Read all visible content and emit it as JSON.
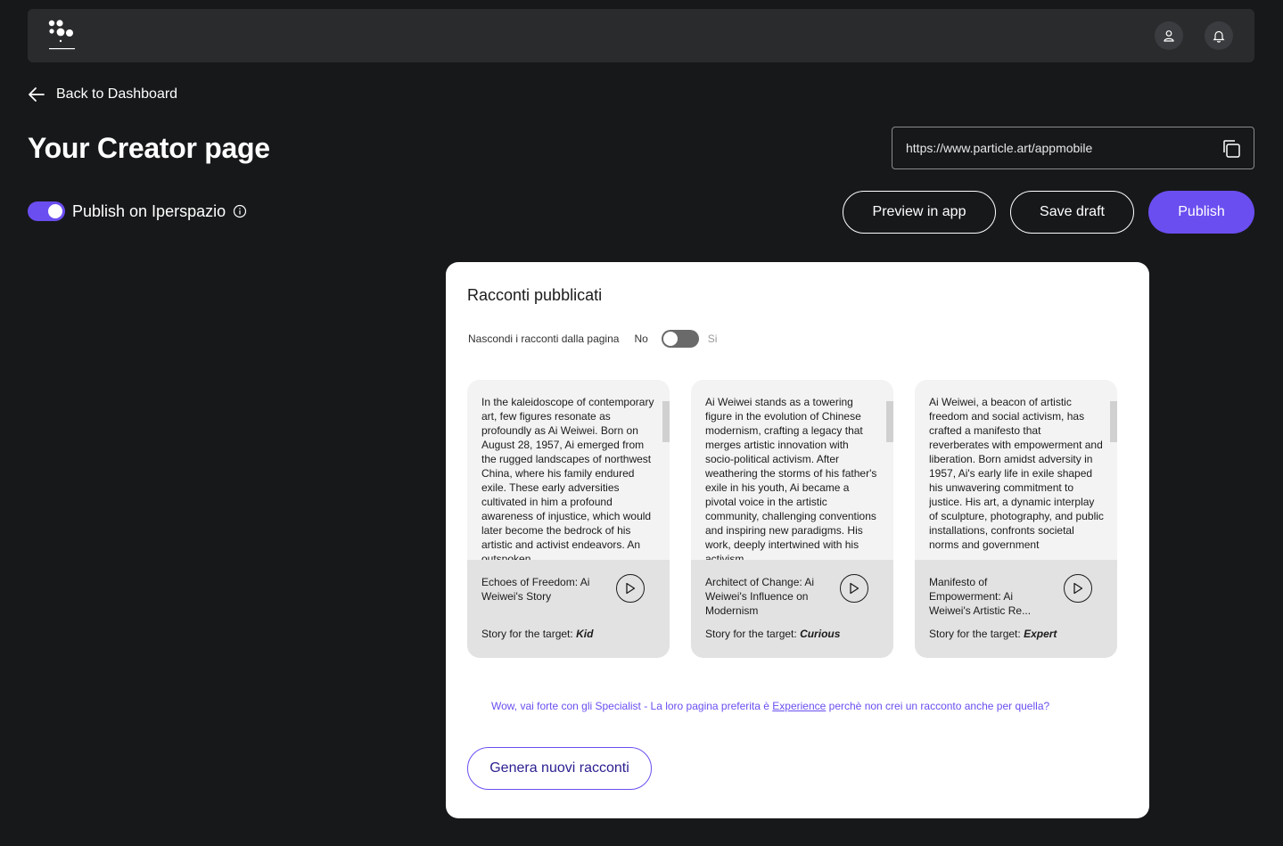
{
  "topbar": {
    "logo_icon": "particle-logo-icon",
    "user_icon": "user-icon",
    "bell_icon": "bell-icon"
  },
  "nav": {
    "back_label": "Back to Dashboard"
  },
  "page": {
    "title": "Your Creator page"
  },
  "url_box": {
    "url": "https://www.particle.art/appmobile"
  },
  "publish_toggle": {
    "label": "Publish on Iperspazio",
    "enabled": true
  },
  "actions": {
    "preview_label": "Preview in app",
    "save_label": "Save draft",
    "publish_label": "Publish"
  },
  "panel": {
    "title": "Racconti pubblicati",
    "hide_label": "Nascondi i racconti dalla pagina",
    "no_label": "No",
    "yes_label": "Si",
    "hide_enabled": false,
    "stories": [
      {
        "text": "In the kaleidoscope of contemporary art, few figures resonate as profoundly as Ai Weiwei. Born on August 28, 1957, Ai emerged from the rugged landscapes of northwest China, where his family endured exile. These early adversities cultivated in him a profound awareness of injustice, which would later become the bedrock of his artistic and activist endeavors. An outspoken",
        "title": "Echoes of Freedom: Ai Weiwei's Story",
        "target_prefix": "Story for the target:",
        "target": "Kid"
      },
      {
        "text": "Ai Weiwei stands as a towering figure in the evolution of Chinese modernism, crafting a legacy that merges artistic innovation with socio-political activism. After weathering the storms of his father's exile in his youth, Ai became a pivotal voice in the artistic community, challenging conventions and inspiring new paradigms. His work, deeply intertwined with his activism",
        "title": "Architect of Change: Ai Weiwei's Influence on Modernism",
        "target_prefix": "Story for the target:",
        "target": "Curious"
      },
      {
        "text": "Ai Weiwei, a beacon of artistic freedom and social activism, has crafted a manifesto that reverberates with empowerment and liberation. Born amidst adversity in 1957, Ai's early life in exile shaped his unwavering commitment to justice. His art, a dynamic interplay of sculpture, photography, and public installations, confronts societal norms and government",
        "title": "Manifesto of Empowerment: Ai Weiwei's Artistic Re...",
        "target_prefix": "Story for the target:",
        "target": "Expert"
      }
    ],
    "hint_before": "Wow, vai forte con gli Specialist - La loro pagina preferita è ",
    "hint_link": "Experience",
    "hint_after": " perchè non crei un racconto anche per quella?",
    "generate_label": "Genera nuovi racconti"
  },
  "colors": {
    "accent": "#6b4ef0",
    "background": "#17181a",
    "topbar": "#2a2b2d",
    "panel": "#ffffff"
  }
}
